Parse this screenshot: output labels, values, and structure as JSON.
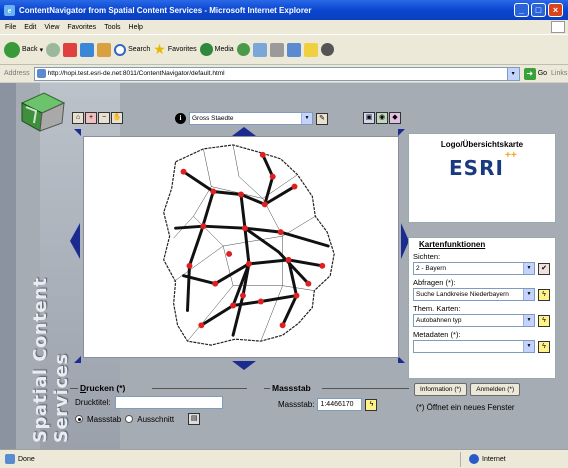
{
  "window": {
    "title": "ContentNavigator from Spatial Content Services - Microsoft Internet Explorer"
  },
  "menu": [
    "File",
    "Edit",
    "View",
    "Favorites",
    "Tools",
    "Help"
  ],
  "toolbar": {
    "back": "Back",
    "search": "Search",
    "favorites": "Favorites",
    "media": "Media"
  },
  "address": {
    "label": "Address",
    "url": "http://hopi.test.esri-de.net:8011/ContentNavigator/default.html",
    "go": "Go",
    "links": "Links"
  },
  "app": {
    "side_title": "Spatial Content Services",
    "layer_select": "Gross Staedte",
    "logo_title": "Logo/Übersichtskarte",
    "logo_text": "ESRI",
    "logo_plus": "++",
    "functions": {
      "title": "Kartenfunktionen",
      "sichten_label": "Sichten:",
      "sichten_value": "2 - Bayern",
      "abfragen_label": "Abfragen (*):",
      "abfragen_value": "Suche Landkreise Niederbayern",
      "karten_label": "Them. Karten:",
      "karten_value": "Autobahnen typ",
      "metadaten_label": "Metadaten (*):",
      "metadaten_value": ""
    },
    "buttons": {
      "information": "Information (*)",
      "anmelden": "Anmelden (*)"
    },
    "note": "(*) Öffnet ein neues Fenster",
    "print": {
      "title_u": "D",
      "title_rest": "rucken (*)",
      "label": "Drucktitel:",
      "value": "",
      "opt1": "Massstab",
      "opt2": "Ausschnitt"
    },
    "scale": {
      "title": "Massstab",
      "label": "Massstab:",
      "value": "1:4466170"
    }
  },
  "status": {
    "text": "Done",
    "zone": "Internet"
  },
  "colors": {
    "titlebar": "#0a46d0",
    "map_points": "#e02020",
    "roads": "#111111"
  }
}
